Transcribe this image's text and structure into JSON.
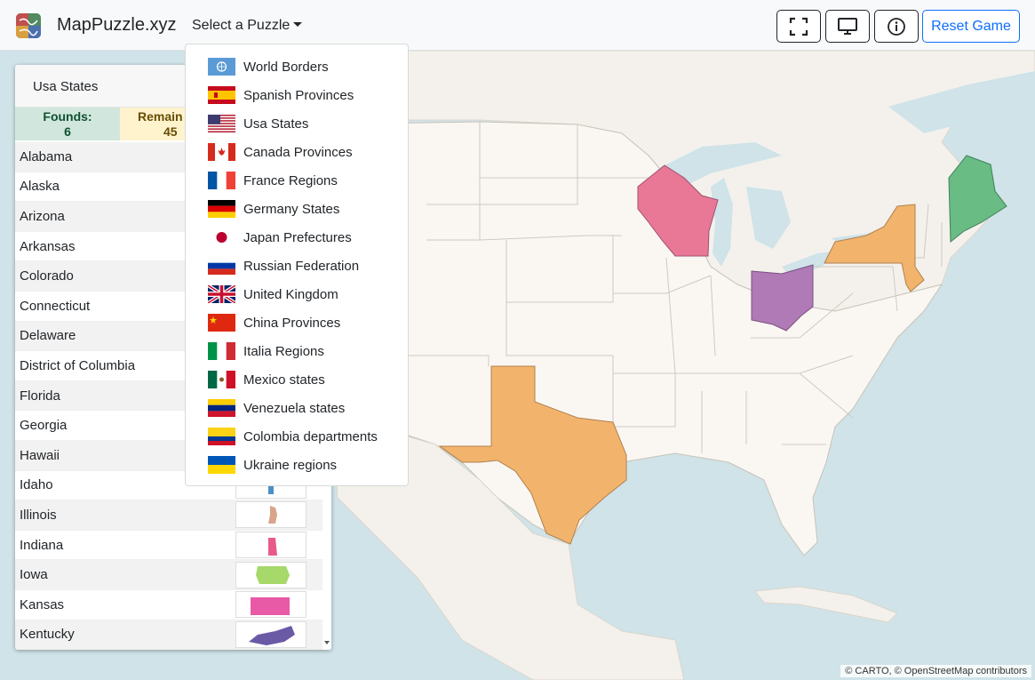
{
  "navbar": {
    "brand": "MapPuzzle.xyz",
    "select_label": "Select a Puzzle",
    "reset_label": "Reset Game",
    "icons": [
      "fullscreen-icon",
      "monitor-icon",
      "info-icon"
    ]
  },
  "dropdown": {
    "items": [
      {
        "label": "World Borders",
        "flag": "un"
      },
      {
        "label": "Spanish Provinces",
        "flag": "es"
      },
      {
        "label": "Usa States",
        "flag": "us"
      },
      {
        "label": "Canada Provinces",
        "flag": "ca"
      },
      {
        "label": "France Regions",
        "flag": "fr"
      },
      {
        "label": "Germany States",
        "flag": "de"
      },
      {
        "label": "Japan Prefectures",
        "flag": "jp"
      },
      {
        "label": "Russian Federation",
        "flag": "ru"
      },
      {
        "label": "United Kingdom",
        "flag": "gb"
      },
      {
        "label": "China Provinces",
        "flag": "cn"
      },
      {
        "label": "Italia Regions",
        "flag": "it"
      },
      {
        "label": "Mexico states",
        "flag": "mx"
      },
      {
        "label": "Venezuela states",
        "flag": "ve"
      },
      {
        "label": "Colombia departments",
        "flag": "co"
      },
      {
        "label": "Ukraine regions",
        "flag": "ua"
      }
    ]
  },
  "panel": {
    "title": "Usa States",
    "found_label": "Founds:",
    "found_value": "6",
    "remain_label": "Remain",
    "remain_value": "45",
    "states": [
      {
        "name": "Alabama",
        "color": ""
      },
      {
        "name": "Alaska",
        "color": ""
      },
      {
        "name": "Arizona",
        "color": ""
      },
      {
        "name": "Arkansas",
        "color": ""
      },
      {
        "name": "Colorado",
        "color": ""
      },
      {
        "name": "Connecticut",
        "color": ""
      },
      {
        "name": "Delaware",
        "color": ""
      },
      {
        "name": "District of Columbia",
        "color": ""
      },
      {
        "name": "Florida",
        "color": ""
      },
      {
        "name": "Georgia",
        "color": ""
      },
      {
        "name": "Hawaii",
        "color": ""
      },
      {
        "name": "Idaho",
        "color": "#4a90c8"
      },
      {
        "name": "Illinois",
        "color": "#d9a48a"
      },
      {
        "name": "Indiana",
        "color": "#e85a8a"
      },
      {
        "name": "Iowa",
        "color": "#a6d86a"
      },
      {
        "name": "Kansas",
        "color": "#e85aa6"
      },
      {
        "name": "Kentucky",
        "color": "#6a5aa6"
      }
    ]
  },
  "map": {
    "attribution": "© CARTO, © OpenStreetMap contributors",
    "found_states": [
      {
        "name": "Wisconsin",
        "color": "#e87896"
      },
      {
        "name": "Ohio",
        "color": "#b07ab6"
      },
      {
        "name": "New York",
        "color": "#f2b46c"
      },
      {
        "name": "Maine",
        "color": "#68bc84"
      },
      {
        "name": "Texas",
        "color": "#f2b46c"
      }
    ]
  }
}
